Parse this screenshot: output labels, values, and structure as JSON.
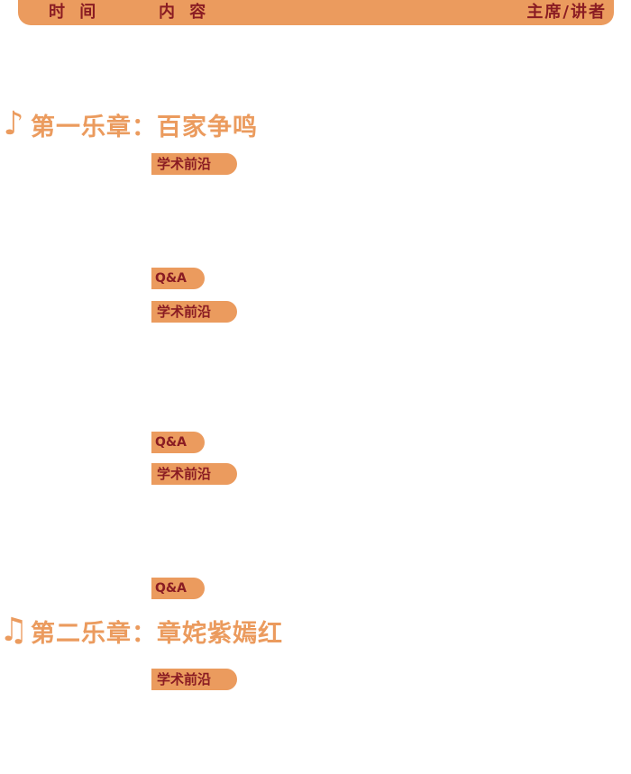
{
  "header": {
    "time_label": "时 间",
    "content_label": "内 容",
    "speaker_label": "主席/讲者"
  },
  "colors": {
    "accent": "#eb9b5e",
    "tag_text": "#8a1c23"
  },
  "chapters": [
    {
      "icon": "eighth-note-icon",
      "title": "第一乐章：百家争鸣",
      "sessions": [
        {
          "tag": "学术前沿",
          "qa": "Q&A"
        },
        {
          "tag": "学术前沿",
          "qa": "Q&A"
        },
        {
          "tag": "学术前沿",
          "qa": "Q&A"
        }
      ]
    },
    {
      "icon": "beamed-notes-icon",
      "title": "第二乐章：章姹紫嫣红",
      "sessions": [
        {
          "tag": "学术前沿"
        }
      ]
    }
  ]
}
